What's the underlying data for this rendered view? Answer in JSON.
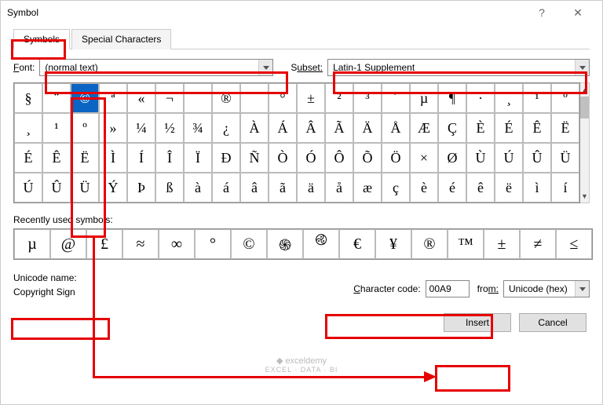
{
  "title": "Symbol",
  "tabs": {
    "symbols": "Symbols",
    "special": "Special Characters"
  },
  "font": {
    "label_pre": "F",
    "label_post": "ont:",
    "value": "(normal text)"
  },
  "subset": {
    "label_pre": "S",
    "label_post": "ubset:",
    "value": "Latin-1 Supplement"
  },
  "grid": [
    [
      "§",
      "¨",
      "©",
      "ª",
      "«",
      "¬",
      "­",
      "®",
      "¯",
      "°",
      "±",
      "²",
      "³",
      "´",
      "µ",
      "¶",
      "·",
      "¸",
      "¹",
      "º"
    ],
    [
      "¸",
      "¹",
      "º",
      "»",
      "¼",
      "½",
      "¾",
      "¿",
      "À",
      "Á",
      "Â",
      "Ã",
      "Ä",
      "Å",
      "Æ",
      "Ç",
      "È",
      "É",
      "Ê",
      "Ë"
    ],
    [
      "É",
      "Ê",
      "Ë",
      "Ì",
      "Í",
      "Î",
      "Ï",
      "Ð",
      "Ñ",
      "Ò",
      "Ó",
      "Ô",
      "Õ",
      "Ö",
      "×",
      "Ø",
      "Ù",
      "Ú",
      "Û",
      "Ü"
    ],
    [
      "Ú",
      "Û",
      "Ü",
      "Ý",
      "Þ",
      "ß",
      "à",
      "á",
      "â",
      "ã",
      "ä",
      "å",
      "æ",
      "ç",
      "è",
      "é",
      "ê",
      "ë",
      "ì",
      "í"
    ]
  ],
  "selected_row": 0,
  "selected_col": 2,
  "recent_label": "Recently used symbols:",
  "recent": [
    "µ",
    "@",
    "£",
    "≈",
    "∞",
    "°",
    "©",
    "֍",
    "࿋",
    "€",
    "¥",
    "®",
    "™",
    "±",
    "≠",
    "≤"
  ],
  "unicode_name_label": "Unicode name:",
  "unicode_name_value": "Copyright Sign",
  "char_code": {
    "label_pre": "C",
    "label_post": "haracter code:",
    "value": "00A9"
  },
  "from": {
    "label_pre": "fro",
    "label_post": "m:",
    "value": "Unicode (hex)"
  },
  "buttons": {
    "insert": "Insert",
    "cancel": "Cancel"
  },
  "watermark": {
    "main": "exceldemy",
    "sub": "EXCEL · DATA · BI"
  }
}
